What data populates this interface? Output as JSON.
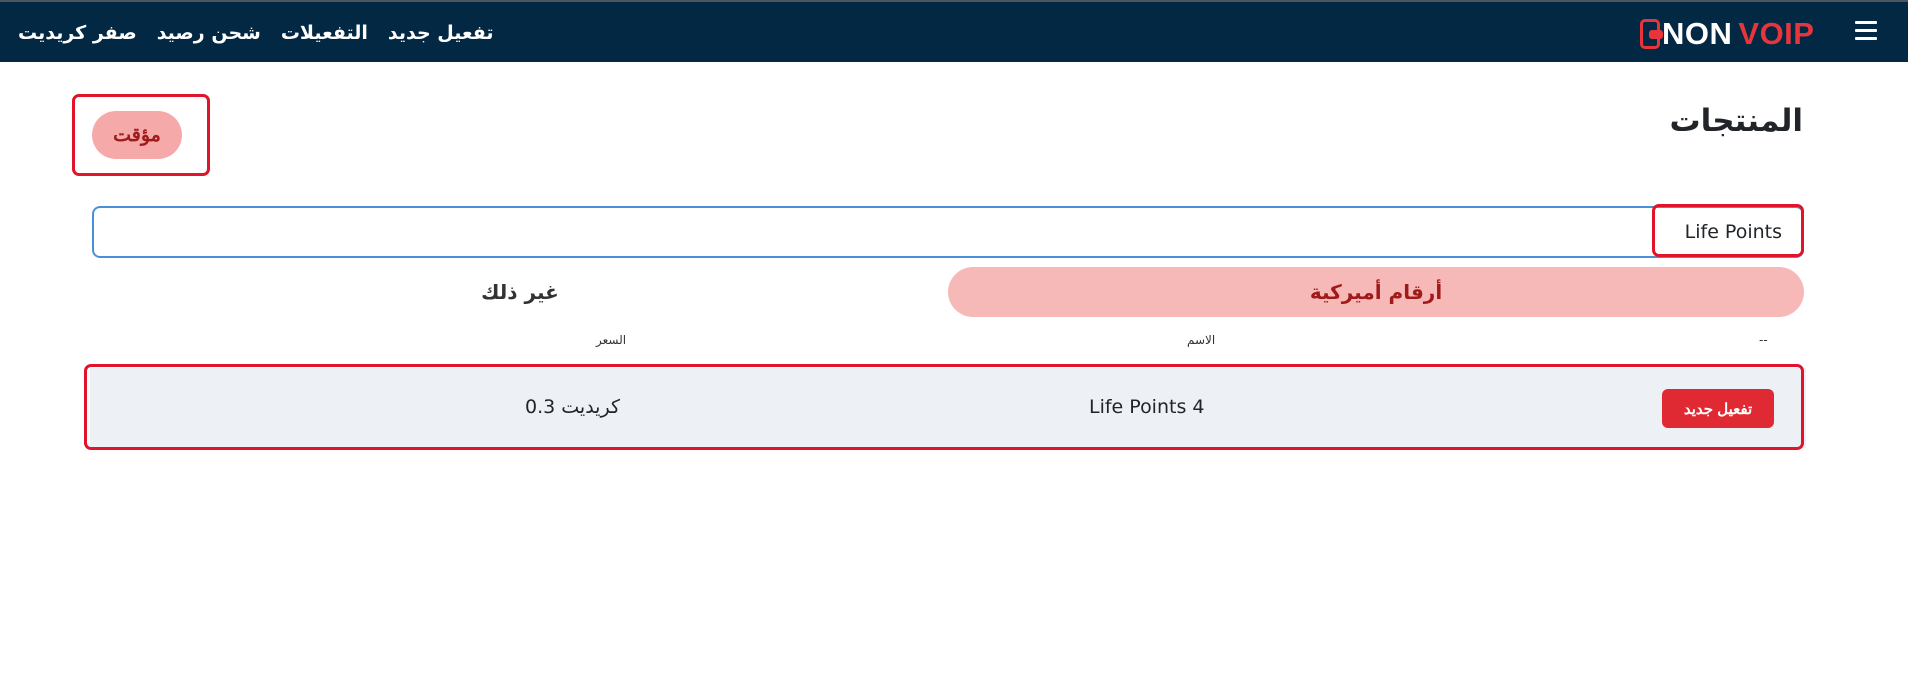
{
  "navbar": {
    "links": [
      "تفعيل جديد",
      "التفعيلات",
      "شحن رصيد",
      "صفر كريديت"
    ],
    "logo": {
      "part1": "NON",
      "part2": "VOIP"
    }
  },
  "page": {
    "title": "المنتجات",
    "timer_label": "مؤقت"
  },
  "search": {
    "value": "Life Points"
  },
  "tabs": {
    "active": "أرقام أميركية",
    "other": "غير ذلك"
  },
  "table": {
    "headers": {
      "col1": "--",
      "name": "الاسم",
      "price": "السعر"
    },
    "rows": [
      {
        "action": "تفعيل جديد",
        "name": "Life Points 4",
        "price": "0.3 كريديت"
      }
    ]
  },
  "colors": {
    "navbar": "#022844",
    "brand_red": "#e8353c",
    "highlight": "#e0142a",
    "tab_active_bg": "#f7b9b8",
    "row_bg": "#edf1f6"
  }
}
